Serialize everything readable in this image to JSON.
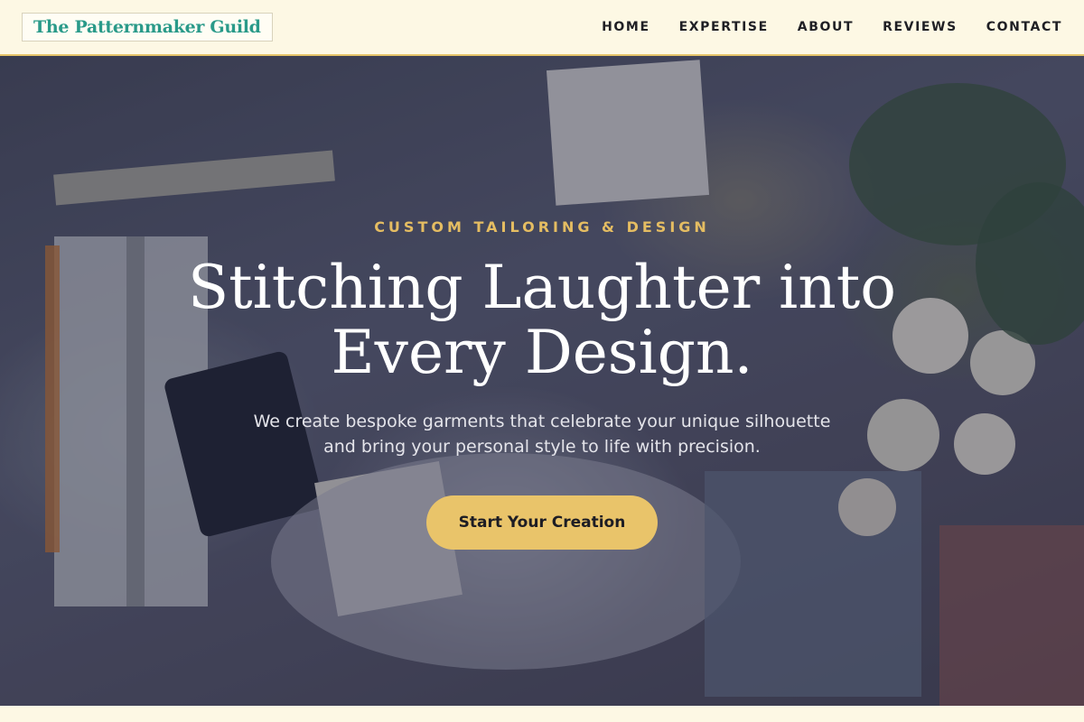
{
  "header": {
    "logo": "The Patternmaker Guild",
    "nav": [
      {
        "label": "HOME"
      },
      {
        "label": "EXPERTISE"
      },
      {
        "label": "ABOUT"
      },
      {
        "label": "REVIEWS"
      },
      {
        "label": "CONTACT"
      }
    ]
  },
  "hero": {
    "eyebrow": "CUSTOM TAILORING & DESIGN",
    "headline": [
      "Stitching Laughter into",
      "Every Design."
    ],
    "subtext": [
      "We create bespoke garments that celebrate your unique silhouette",
      "and bring your personal style to life with precision."
    ],
    "cta_label": "Start Your Creation"
  },
  "colors": {
    "brand": "#2a9a89",
    "accent": "#e9c46a",
    "eyebrow": "#e5bd62",
    "background": "#fdf8e4"
  }
}
